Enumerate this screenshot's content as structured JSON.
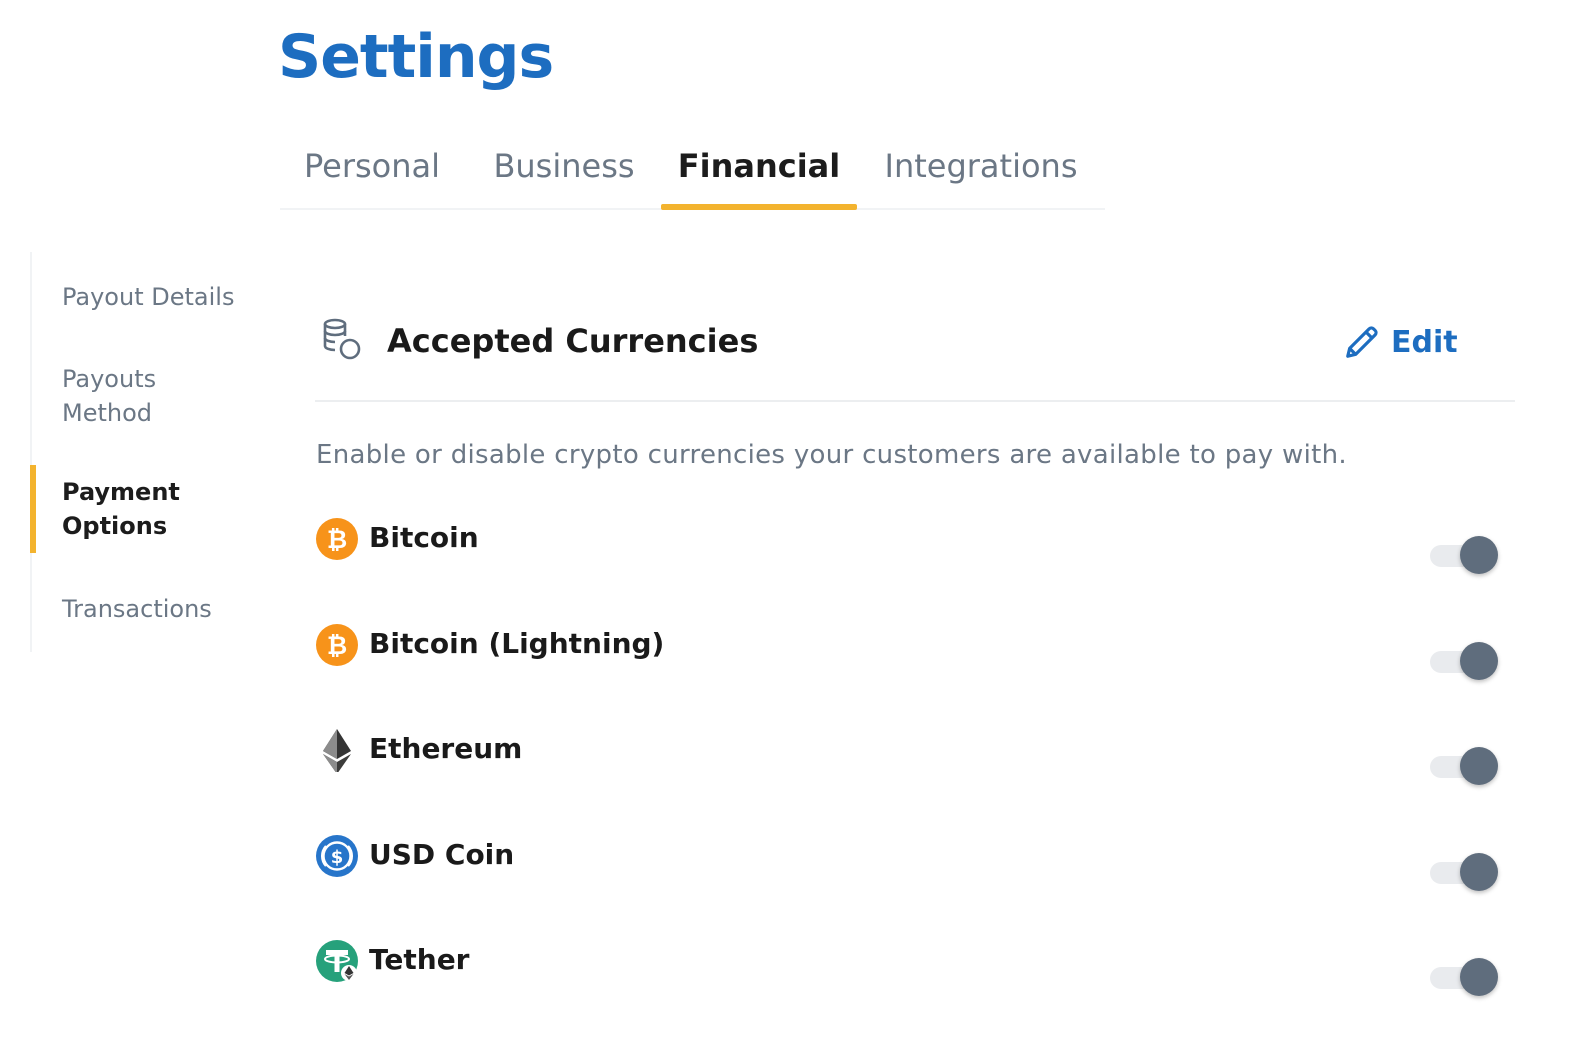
{
  "page": {
    "title": "Settings"
  },
  "tabs": [
    {
      "label": "Personal"
    },
    {
      "label": "Business"
    },
    {
      "label": "Financial",
      "active": true
    },
    {
      "label": "Integrations"
    }
  ],
  "sidenav": [
    {
      "label": "Payout Details"
    },
    {
      "label": "Payouts Method"
    },
    {
      "label": "Payment Options",
      "active": true
    },
    {
      "label": "Transactions"
    }
  ],
  "section": {
    "icon": "coins-stack-icon",
    "title": "Accepted Currencies",
    "edit_label": "Edit",
    "edit_icon": "pencil-icon",
    "description": "Enable or disable crypto currencies your customers are available to pay with."
  },
  "currencies": [
    {
      "name": "Bitcoin",
      "icon": "bitcoin-icon",
      "enabled": true
    },
    {
      "name": "Bitcoin (Lightning)",
      "icon": "bitcoin-icon",
      "enabled": true
    },
    {
      "name": "Ethereum",
      "icon": "ethereum-icon",
      "enabled": true
    },
    {
      "name": "USD Coin",
      "icon": "usd-coin-icon",
      "enabled": true
    },
    {
      "name": "Tether",
      "icon": "tether-icon",
      "enabled": true
    }
  ],
  "colors": {
    "brand_blue": "#1d6dc0",
    "accent_yellow": "#f3b32e",
    "toggle_knob": "#5f6d7d",
    "toggle_track": "#e9ebee",
    "muted_text": "#6b7785",
    "bitcoin_orange": "#f7931a",
    "usdc_blue": "#2775ca",
    "tether_green": "#26a17b"
  }
}
